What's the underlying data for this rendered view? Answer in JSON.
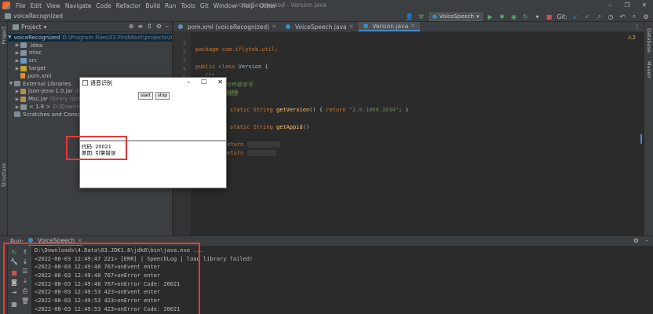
{
  "menubar": {
    "items": [
      "File",
      "Edit",
      "View",
      "Navigate",
      "Code",
      "Refactor",
      "Build",
      "Run",
      "Tools",
      "Git",
      "Window",
      "Help",
      "Other"
    ],
    "window_title": "voiceRecognized - Version.java"
  },
  "navbar": {
    "project_name": "voiceRecognized",
    "run_config": "VoiceSpeech",
    "git_label": "Git:"
  },
  "left_stripe": {
    "project_label": "Project",
    "structure_label": "Structure"
  },
  "right_stripe": {
    "database_label": "Database",
    "maven_label": "Maven"
  },
  "project_panel": {
    "title": "Project",
    "tree": [
      {
        "label": "voiceRecognized",
        "detail": "D:\\Program Files\\03.FindWork\\projects\\008.pro"
      },
      {
        "label": ".idea"
      },
      {
        "label": "misc"
      },
      {
        "label": "src"
      },
      {
        "label": "target"
      },
      {
        "label": "pom.xml"
      },
      {
        "label": "External Libraries"
      },
      {
        "label": "json-jena-1.0.jar",
        "detail": "lib"
      },
      {
        "label": "Msc.jar",
        "detail": "library root"
      },
      {
        "label": "< 1.8 >",
        "detail": "D:\\Download"
      },
      {
        "label": "Scratches and Consoles"
      }
    ]
  },
  "editor": {
    "tabs": [
      "pom.xml (voiceRecognized)",
      "VoiceSpeech.java",
      "Version.java"
    ],
    "warning": "2",
    "lines": {
      "l1": "package com.iflytek.util;",
      "l3a": "public class ",
      "l3b": "Version",
      "l3c": " {",
      "l4": "/**",
      "l5": "* 获取控件版本号",
      "l6": "* @return",
      "l8a": "static String ",
      "l8b": "getVersion",
      "l8c": "() { ",
      "l8d": "return ",
      "l8e": "\"2.0.1009.1034\"",
      "l8f": "; }",
      "l10a": "static String ",
      "l10b": "getAppid",
      "l10c": "()",
      "l12": "return",
      "l13": "return"
    }
  },
  "dialog": {
    "title": "语音识别",
    "start": "start",
    "stop": "stop",
    "code_line": "代码: 20021",
    "reason_line": "原因: 引擎错误"
  },
  "run_panel": {
    "label": "Run:",
    "tab": "VoiceSpeech",
    "console": [
      "D:\\Downloads\\4.Data\\03.JDK1.8\\jdk8\\bin\\java.exe ...",
      "<2022-08-03 12:49:47 221> [ERR] | SpeechLog | load library failed!",
      "<2022-08-03 12:49:48 767>onEvent enter",
      "<2022-08-03 12:49:48 767>onError enter",
      "<2022-08-03 12:49:48 767>onError Code: 20021",
      "<2022-08-03 12:49:53 423>onEvent enter",
      "<2022-08-03 12:49:53 423>onError enter",
      "<2022-08-03 12:49:53 423>onError Code: 20021"
    ]
  },
  "colors": {
    "accent": "#4a88c7",
    "annotation": "#e53935",
    "background": "#2b2b2b",
    "panel": "#3c3f41"
  }
}
